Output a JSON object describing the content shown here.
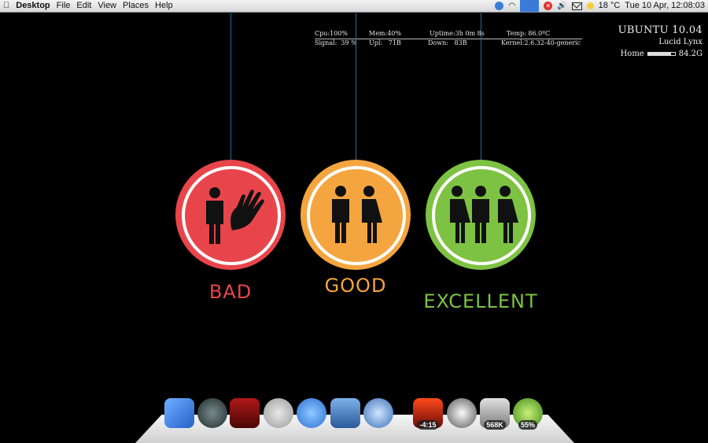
{
  "menubar": {
    "app_name": "Desktop",
    "menus": [
      "File",
      "Edit",
      "View",
      "Places",
      "Help"
    ],
    "weather": "18 °C",
    "datetime": "Tue 10 Apr, 12:08:03"
  },
  "stats": {
    "cpu": "Cpu:100%",
    "mem": "Mem:40%",
    "uptime": "Uptime:3h 0m 8s",
    "temp": "Temp: 86.0ºC",
    "signal": "Signal:  39 %",
    "upl": "Upl:   71B",
    "down": "Down:   83B",
    "kernel": "Kernel:2.6.32-40-generic"
  },
  "sysinfo": {
    "os": "UBUNTU 10.04",
    "codename": "Lucid Lynx",
    "home_label": "Home",
    "home_size": "84.2G",
    "home_usage_fraction": 0.85
  },
  "wallpaper": {
    "items": [
      {
        "label": "BAD",
        "color": "#e8454b"
      },
      {
        "label": "GOOD",
        "color": "#f5a53f"
      },
      {
        "label": "EXCELLENT",
        "color": "#7dc242"
      }
    ]
  },
  "dock": {
    "icons": [
      {
        "name": "finder-icon",
        "badge": ""
      },
      {
        "name": "time-machine-icon",
        "badge": ""
      },
      {
        "name": "photo-booth-icon",
        "badge": ""
      },
      {
        "name": "itunes-icon",
        "badge": ""
      },
      {
        "name": "ichat-icon",
        "badge": ""
      },
      {
        "name": "mail-icon",
        "badge": ""
      },
      {
        "name": "safari-icon",
        "badge": ""
      },
      {
        "name": "battery-fire-icon",
        "badge": "-4:15"
      },
      {
        "name": "clock-icon",
        "badge": ""
      },
      {
        "name": "trash-icon",
        "badge": "568K"
      },
      {
        "name": "globe-icon",
        "badge": "55%"
      }
    ]
  }
}
